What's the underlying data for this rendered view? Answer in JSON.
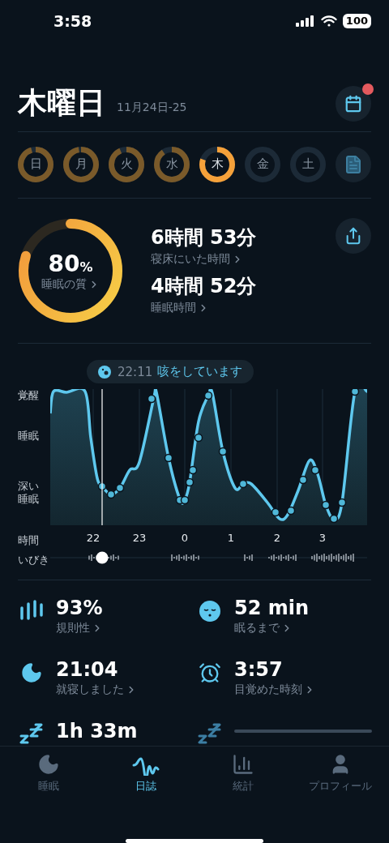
{
  "status_bar": {
    "time": "3:58",
    "battery": "100"
  },
  "header": {
    "title": "木曜日",
    "date_range": "11月24日-25",
    "calendar_badge": true
  },
  "week": [
    {
      "label": "日",
      "selected": false
    },
    {
      "label": "月",
      "selected": false
    },
    {
      "label": "火",
      "selected": false
    },
    {
      "label": "水",
      "selected": false
    },
    {
      "label": "木",
      "selected": true
    },
    {
      "label": "金",
      "selected": false
    },
    {
      "label": "土",
      "selected": false
    }
  ],
  "summary": {
    "quality": {
      "value": "80",
      "unit": "%",
      "label": "睡眠の質"
    },
    "metrics": [
      {
        "value": "6時間 53分",
        "label": "寝床にいた時間"
      },
      {
        "value": "4時間 52分",
        "label": "睡眠時間"
      }
    ]
  },
  "graph": {
    "tooltip": {
      "time": "22:11",
      "text": "咳をしています"
    },
    "y_labels": [
      "覚醒",
      "睡眠",
      "深い睡眠"
    ],
    "x_title": "時間",
    "x_labels": [
      "22",
      "23",
      "0",
      "1",
      "2",
      "3"
    ],
    "snore_label": "いびき"
  },
  "stats": [
    {
      "kind": "value",
      "value": "93%",
      "label": "規則性"
    },
    {
      "kind": "value",
      "value": "52 min",
      "label": "眠るまで"
    },
    {
      "kind": "value",
      "value": "21:04",
      "label": "就寝しました"
    },
    {
      "kind": "value",
      "value": "3:57",
      "label": "目覚めた時刻"
    },
    {
      "kind": "value",
      "value": "1h 33m"
    },
    {
      "kind": "loading"
    }
  ],
  "tabs": [
    {
      "label": "睡眠",
      "selected": false
    },
    {
      "label": "日誌",
      "selected": true
    },
    {
      "label": "統計",
      "selected": false
    },
    {
      "label": "プロフィール",
      "selected": false
    }
  ]
}
